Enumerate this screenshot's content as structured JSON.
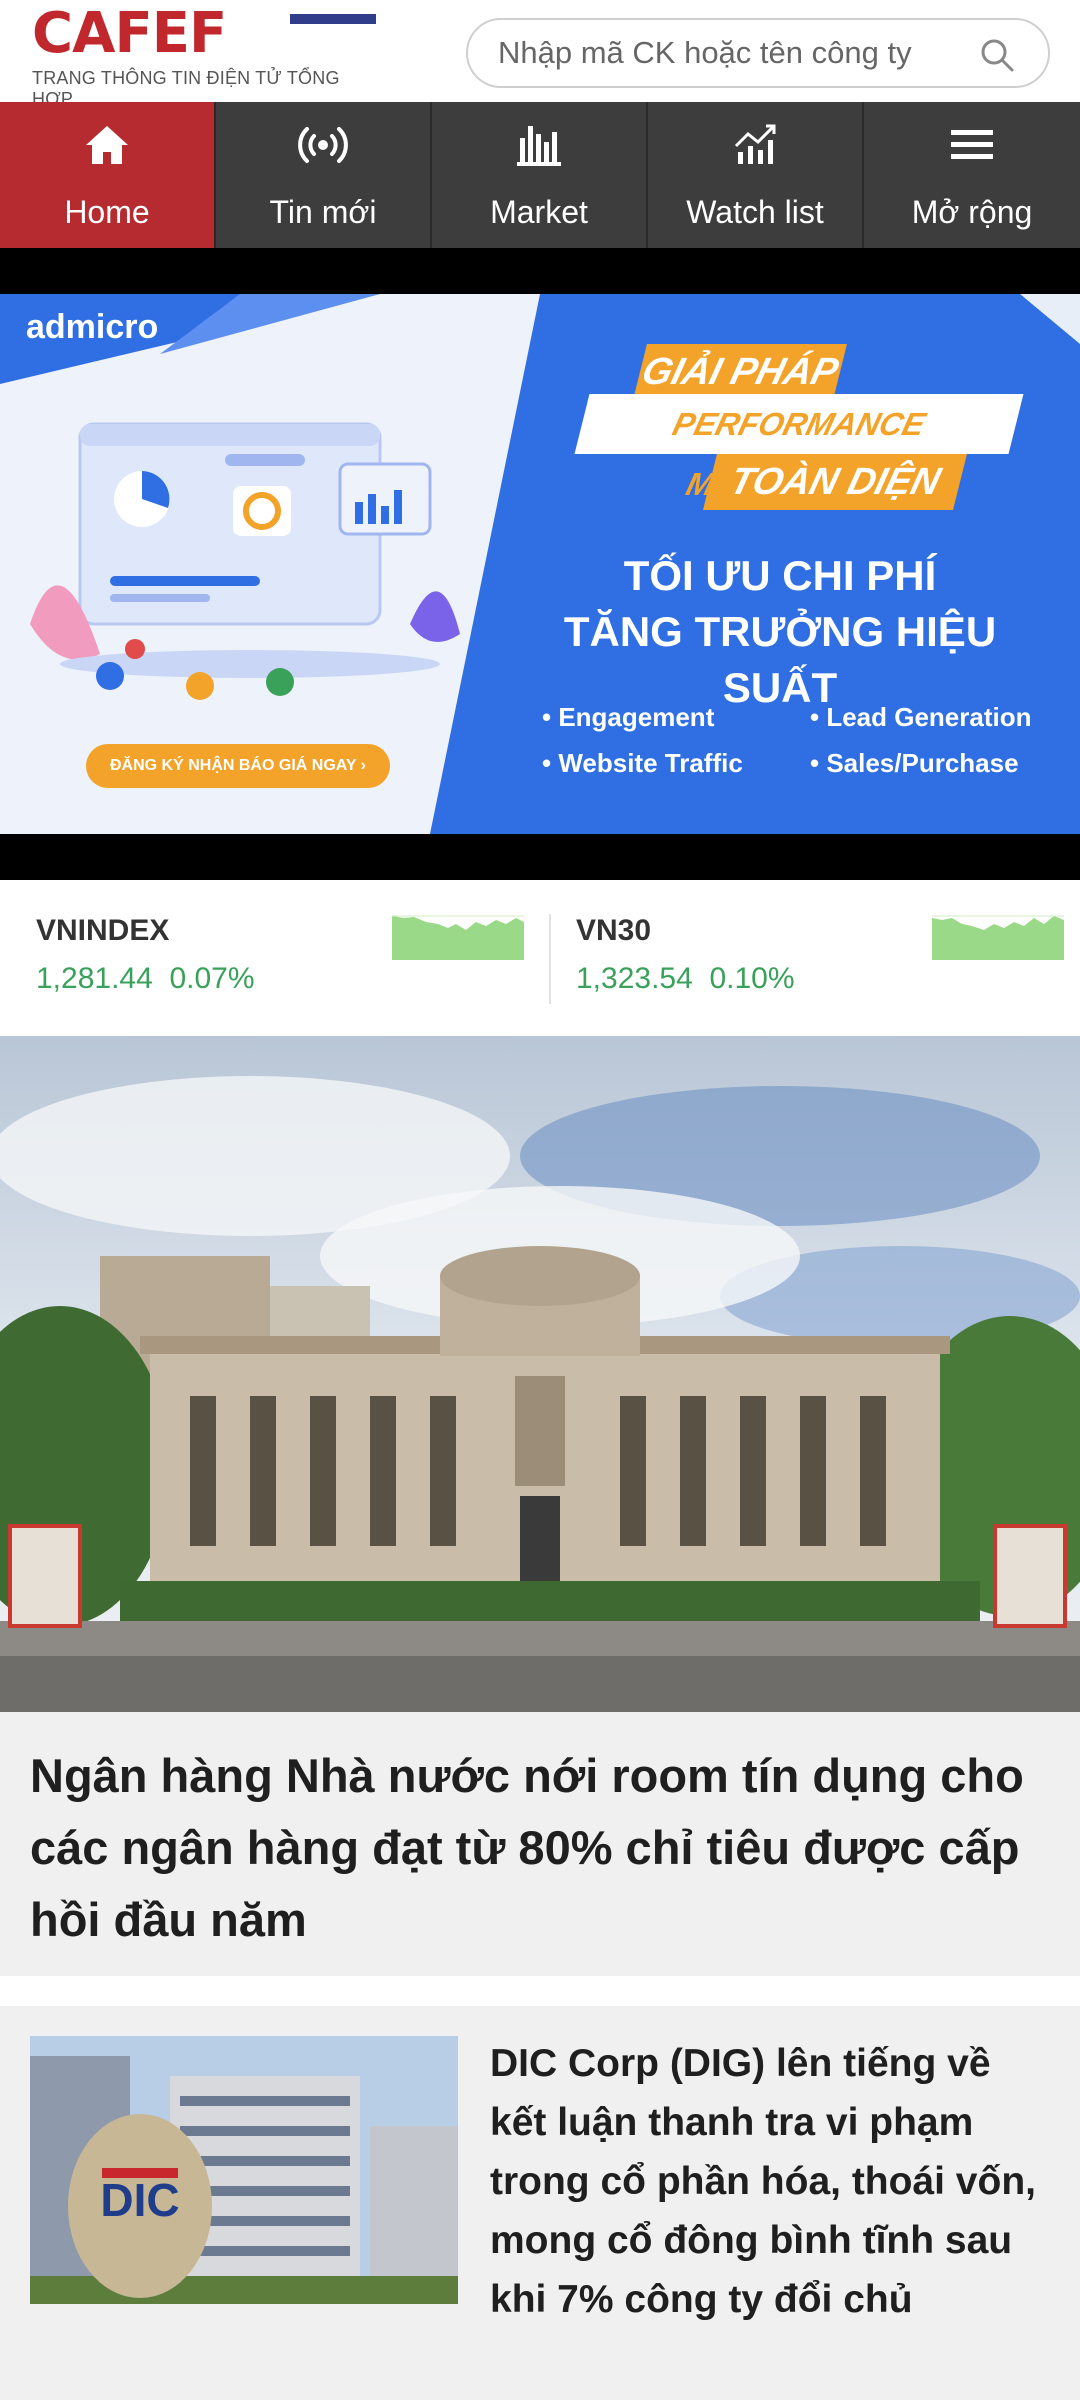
{
  "header": {
    "logo_text": "CAFEF",
    "logo_tagline": "TRANG THÔNG TIN ĐIỆN TỬ TỔNG HỢP",
    "search_placeholder": "Nhập mã CK hoặc tên công ty"
  },
  "nav": {
    "items": [
      {
        "label": "Home",
        "icon": "home-icon",
        "active": true
      },
      {
        "label": "Tin mới",
        "icon": "broadcast-icon",
        "active": false
      },
      {
        "label": "Market",
        "icon": "bar-chart-icon",
        "active": false
      },
      {
        "label": "Watch list",
        "icon": "trend-chart-icon",
        "active": false
      },
      {
        "label": "Mở rộng",
        "icon": "menu-icon",
        "active": false
      }
    ]
  },
  "banner": {
    "advertiser": "admicro",
    "line1": "GIẢI PHÁP",
    "line2": "PERFORMANCE MARKETING",
    "line3": "TOÀN DIỆN",
    "sub1": "TỐI ƯU CHI PHÍ",
    "sub2": "TĂNG TRƯỞNG HIỆU SUẤT",
    "bullets": [
      "• Engagement",
      "• Lead Generation",
      "• Website Traffic",
      "• Sales/Purchase"
    ],
    "cta": "ĐĂNG KÝ NHẬN BÁO GIÁ NGAY ›"
  },
  "indices": [
    {
      "name": "VNINDEX",
      "value": "1,281.44",
      "change": "0.07%"
    },
    {
      "name": "VN30",
      "value": "1,323.54",
      "change": "0.10%"
    }
  ],
  "articles": {
    "hero_title": "Ngân hàng Nhà nước nới room tín dụng cho các ngân hàng đạt từ 80% chỉ tiêu được cấp hồi đầu năm",
    "second_title": "DIC Corp (DIG) lên tiếng về kết luận thanh tra vi phạm trong cổ phần hóa, thoái vốn, mong cổ đông bình tĩnh sau khi 7% công ty đổi chủ",
    "second_image_text": "DIC"
  },
  "colors": {
    "brand_red": "#b52b2f",
    "nav_bg": "#3d3d3d",
    "positive_green": "#3aa15a",
    "banner_blue": "#2f6fe3",
    "banner_orange": "#f3a329"
  }
}
